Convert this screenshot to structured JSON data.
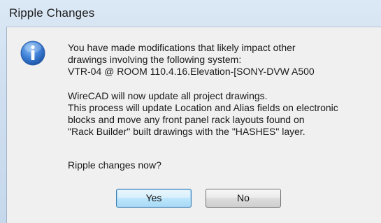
{
  "window": {
    "title": "Ripple Changes"
  },
  "icon": {
    "name": "info-icon",
    "glyph": "i",
    "color_top": "#6aa6ea",
    "color_bottom": "#1f5fb8"
  },
  "message": {
    "lines1": [
      "You have made modifications that likely impact other",
      "drawings involving the following system:",
      "VTR-04 @ ROOM 110.4.16.Elevation-[SONY-DVW A500"
    ],
    "lines2": [
      "WireCAD will now update all project drawings.",
      "This process will update Location and Alias fields on electronic",
      "blocks and move any front panel rack layouts found on",
      "\"Rack Builder\" built drawings with the \"HASHES\" layer."
    ],
    "prompt": "Ripple changes now?"
  },
  "buttons": {
    "yes_label": "Yes",
    "no_label": "No"
  }
}
